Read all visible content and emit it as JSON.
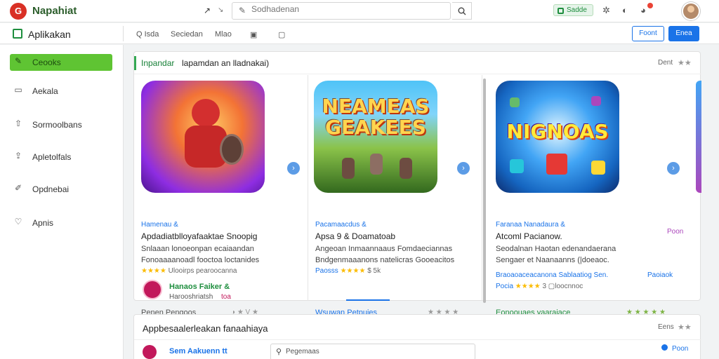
{
  "app": {
    "logo_text": "G",
    "name": "Napahiat"
  },
  "topbar": {
    "back_glyph": "↗",
    "forward_glyph": "↘",
    "search_placeholder": "Sodhadenan",
    "status_pill": "Sadde"
  },
  "subbar": {
    "title": "Aplikakan",
    "tabs": [
      "Q  Isda",
      "Seciedan",
      "Mlao",
      "▣",
      "▢"
    ],
    "btn_outline": "Foont",
    "btn_primary": "Enea"
  },
  "sidebar": {
    "items": [
      {
        "label": "Ceooks",
        "icon": "pencil-icon",
        "glyph": "✎",
        "active": true
      },
      {
        "label": "Aekala",
        "icon": "screen-icon",
        "glyph": "▭",
        "active": false
      },
      {
        "label": "Sormoolbans",
        "icon": "share-icon",
        "glyph": "⇧",
        "active": false
      },
      {
        "label": "Apletolfals",
        "icon": "export-icon",
        "glyph": "⇪",
        "active": false
      },
      {
        "label": "Opdnebai",
        "icon": "edit-icon",
        "glyph": "✐",
        "active": false
      },
      {
        "label": "Apnis",
        "icon": "heart-icon",
        "glyph": "♡",
        "active": false
      }
    ]
  },
  "panel": {
    "tag": "Inpandar",
    "title": "lapamdan an lladnakai)",
    "more": "Dent",
    "more_stars": "★★",
    "cards": [
      {
        "image_title": "",
        "category": "Hamenau &",
        "title": "Apdadiatblloyafaaktae Snoopig",
        "desc": [
          "Snlaaan lonoeonpan ecaiaandan",
          "Fonoaaaanoadl fooctoa loctanides"
        ],
        "rating_prefix": "",
        "stars": "★★★★",
        "rating_text": "Ulooirps pearoocanna",
        "dev_name": "Hanaos Faiker &",
        "dev_sub": "Harooshriatsh",
        "dev_badge": "toa",
        "footer": "Penen Pengoos",
        "footer_icons": "◑  ★  V  ★"
      },
      {
        "image_title": "NEAMEAS GEAKEES",
        "category": "Pacamaacdus &",
        "title": "Apsa 9 & Doamatoab",
        "desc": [
          "Angeoan Inmaannaaus Fomdaeciannas",
          "Bndgenmaaanons natelicras Gooeacitos"
        ],
        "rating_prefix": "Paosss",
        "stars": "★★★★",
        "rating_text": "$  5k",
        "footer": "Wsuwan Petpuies",
        "footer_icons": "★  ★  ★  ★"
      },
      {
        "image_title": "NIGNOAS",
        "category": "Faranaa Nanadaura &",
        "title": "Atcoml Pacianow.",
        "desc": [
          "Seodalnan Haotan edenandaerana",
          "Sengaer et Naanaanns (|doeaoc."
        ],
        "rating_prefix": "",
        "stars": "",
        "rating_text": "Braoaoaceacanona Sablaatiog Sen.",
        "rating2_prefix": "Pocia",
        "rating2_stars": "★★★★",
        "rating2_text": "3  ▢loocnnoc",
        "side_link": "Paoiaok",
        "footer": "Eonoouaes yaaraiace",
        "footer_icons": "★  ★  ★  ★  ★"
      }
    ],
    "edge_label": "Poon"
  },
  "panel2": {
    "title": "Appbesaalerleakan fanaahiaya",
    "more": "Eens",
    "more_stars": "★★",
    "dev_name": "Sem Aakuenn tt",
    "search_text": "Pegemaas",
    "link": "Poon"
  },
  "colors": {
    "accent_green": "#5fc433",
    "brand_blue": "#1a73e8",
    "star": "#fbbc04"
  }
}
